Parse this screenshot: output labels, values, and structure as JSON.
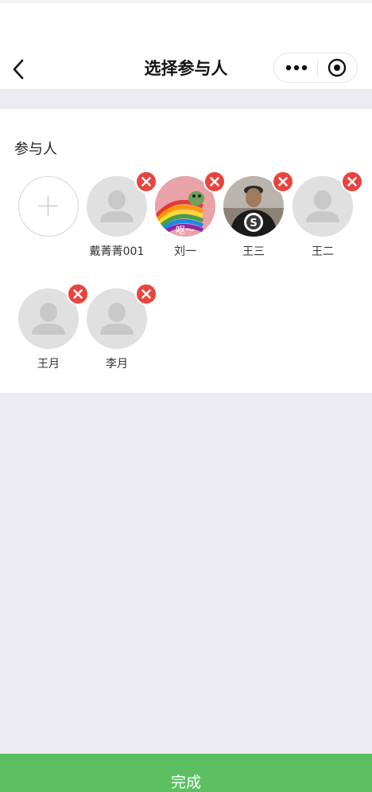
{
  "header": {
    "title": "选择参与人",
    "back_icon": "chevron-left-icon",
    "more_icon": "more-dots-icon",
    "target_icon": "target-circle-icon"
  },
  "participants": {
    "label": "参与人",
    "add_icon": "plus-icon",
    "remove_icon": "close-icon",
    "people": [
      {
        "name": "戴菁菁001",
        "avatar": "default-avatar"
      },
      {
        "name": "刘一",
        "avatar": "cartoon-rainbow-photo",
        "overlay_text": "呕～"
      },
      {
        "name": "王三",
        "avatar": "man-photo"
      },
      {
        "name": "王二",
        "avatar": "default-avatar"
      },
      {
        "name": "王月",
        "avatar": "default-avatar"
      },
      {
        "name": "李月",
        "avatar": "default-avatar"
      }
    ]
  },
  "footer": {
    "done_label": "完成"
  },
  "colors": {
    "accent_green": "#5cc062",
    "remove_red": "#e8443d",
    "page_background": "#ebebf0"
  }
}
